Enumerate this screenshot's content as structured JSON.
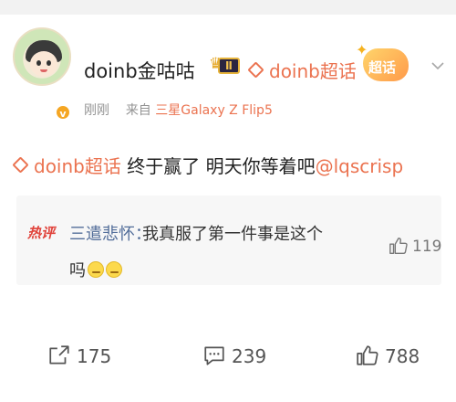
{
  "post": {
    "author": "doinb金咕咕",
    "level_badge": "Ⅱ",
    "topic_link": "doinb超话",
    "chaohua_badge": "超话",
    "time": "刚刚",
    "source_prefix": "来自",
    "device": "三星Galaxy Z Flip5",
    "text": {
      "topic": "doinb超话",
      "body": " 终于赢了 明天你等着吧",
      "mention": "@lqscrisp"
    }
  },
  "hot_comment": {
    "tag": "热评",
    "author": "三遣悲怀：",
    "line1": "我真服了第一件事是这个",
    "line2": "吗",
    "likes": "119"
  },
  "actions": {
    "reposts": "175",
    "comments": "239",
    "likes": "788"
  },
  "colors": {
    "accent": "#eb7350",
    "link_blue": "#536e9a",
    "hot_red": "#e0423a"
  },
  "icons": [
    "avatar",
    "vip-badge",
    "crown-badge",
    "diamond-icon",
    "chaohua-badge",
    "chevron-down-icon",
    "thumb-up-icon",
    "repost-icon",
    "comment-icon"
  ]
}
